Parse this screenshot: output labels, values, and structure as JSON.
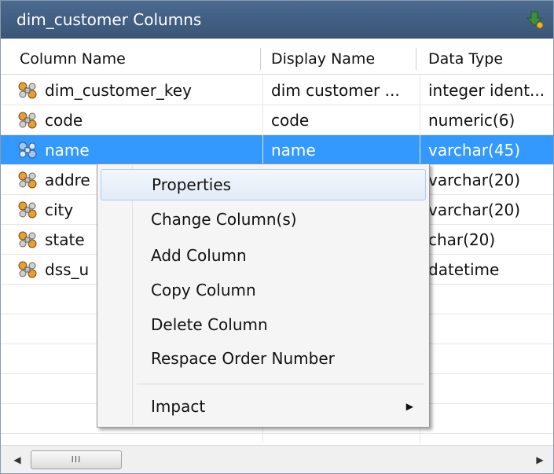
{
  "panel": {
    "title": "dim_customer  Columns",
    "title_icon": "add-column-icon"
  },
  "columns": [
    {
      "label": "Column Name"
    },
    {
      "label": "Display Name"
    },
    {
      "label": "Data Type"
    }
  ],
  "rows": [
    {
      "name": "dim_customer_key",
      "display": "dim customer ...",
      "type": "integer ident...",
      "selected": false
    },
    {
      "name": "code",
      "display": "code",
      "type": "numeric(6)",
      "selected": false
    },
    {
      "name": "name",
      "display": "name",
      "type": "varchar(45)",
      "selected": true
    },
    {
      "name": "addre",
      "display": "",
      "type": "varchar(20)",
      "selected": false
    },
    {
      "name": "city",
      "display": "",
      "type": "varchar(20)",
      "selected": false
    },
    {
      "name": "state",
      "display": "",
      "type": "char(20)",
      "selected": false
    },
    {
      "name": "dss_u",
      "display": "",
      "type": "datetime",
      "selected": false
    }
  ],
  "row_icon": "column-key-icon",
  "context_menu": {
    "items": [
      {
        "label": "Properties"
      },
      {
        "label": "Change Column(s)"
      },
      {
        "label": "Add Column"
      },
      {
        "label": "Copy Column"
      },
      {
        "label": "Delete Column"
      },
      {
        "label": "Respace Order Number"
      },
      {
        "label": "Impact"
      }
    ],
    "highlighted": "Properties",
    "submenu_arrow": "▶"
  },
  "scrollbar": {
    "left_arrow": "◀",
    "right_arrow": "▶",
    "thumb_grip": "III"
  },
  "colors": {
    "title_bg": "#3f5b80",
    "selection": "#3399ff",
    "menu_bg": "#f5f5f5"
  }
}
